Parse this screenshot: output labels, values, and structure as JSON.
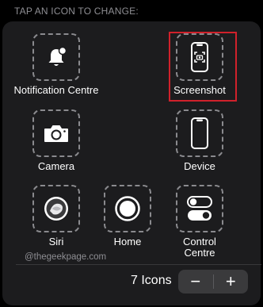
{
  "header": "TAP AN ICON TO CHANGE:",
  "icons": {
    "notification_centre": {
      "label": "Notification Centre",
      "icon": "bell-badge-icon"
    },
    "screenshot": {
      "label": "Screenshot",
      "icon": "screenshot-phone-icon",
      "selected": true
    },
    "camera": {
      "label": "Camera",
      "icon": "camera-icon"
    },
    "device": {
      "label": "Device",
      "icon": "iphone-icon"
    },
    "siri": {
      "label": "Siri",
      "icon": "siri-icon"
    },
    "home": {
      "label": "Home",
      "icon": "home-button-icon"
    },
    "control_centre": {
      "label": "Control Centre",
      "icon": "toggles-icon"
    }
  },
  "watermark": "@thegeekpage.com",
  "footer": {
    "count_label": "7 Icons",
    "decrement": "−",
    "increment": "+"
  },
  "colors": {
    "background": "#000000",
    "panel": "#1c1c1e",
    "selection_outline": "#d0212b",
    "stepper": "#3a3a3c",
    "muted_text": "#8e8e93"
  }
}
